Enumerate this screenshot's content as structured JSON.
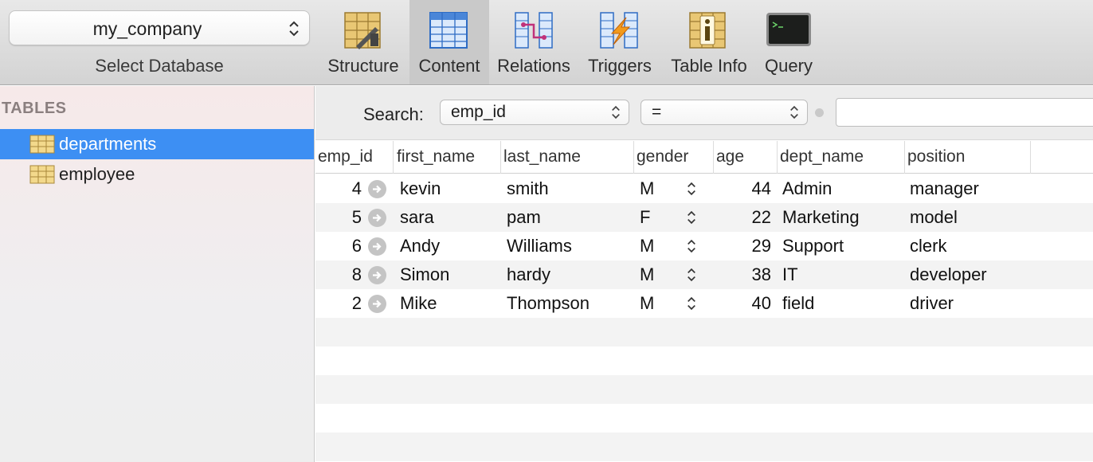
{
  "database": {
    "selected": "my_company",
    "label": "Select Database"
  },
  "toolbar": {
    "items": [
      {
        "label": "Structure",
        "icon": "structure-icon"
      },
      {
        "label": "Content",
        "icon": "content-icon",
        "active": true
      },
      {
        "label": "Relations",
        "icon": "relations-icon"
      },
      {
        "label": "Triggers",
        "icon": "triggers-icon"
      },
      {
        "label": "Table Info",
        "icon": "table-info-icon"
      },
      {
        "label": "Query",
        "icon": "query-icon"
      }
    ]
  },
  "sidebar": {
    "header": "TABLES",
    "items": [
      {
        "label": "departments",
        "selected": true
      },
      {
        "label": "employee",
        "selected": false
      }
    ]
  },
  "search": {
    "label": "Search:",
    "field": "emp_id",
    "operator": "=",
    "value": ""
  },
  "table": {
    "columns": [
      "emp_id",
      "first_name",
      "last_name",
      "gender",
      "age",
      "dept_name",
      "position"
    ],
    "rows": [
      [
        "4",
        "kevin",
        "smith",
        "M",
        "44",
        "Admin",
        "manager"
      ],
      [
        "5",
        "sara",
        "pam",
        "F",
        "22",
        "Marketing",
        "model"
      ],
      [
        "6",
        "Andy",
        "Williams",
        "M",
        "29",
        "Support",
        "clerk"
      ],
      [
        "8",
        "Simon",
        "hardy",
        "M",
        "38",
        "IT",
        "developer"
      ],
      [
        "2",
        "Mike",
        "Thompson",
        "M",
        "40",
        "field",
        "driver"
      ]
    ]
  },
  "colors": {
    "selection": "#3d8ff3",
    "toolbar_bg": "#dcdcdc",
    "row_alt": "#f3f3f3"
  }
}
